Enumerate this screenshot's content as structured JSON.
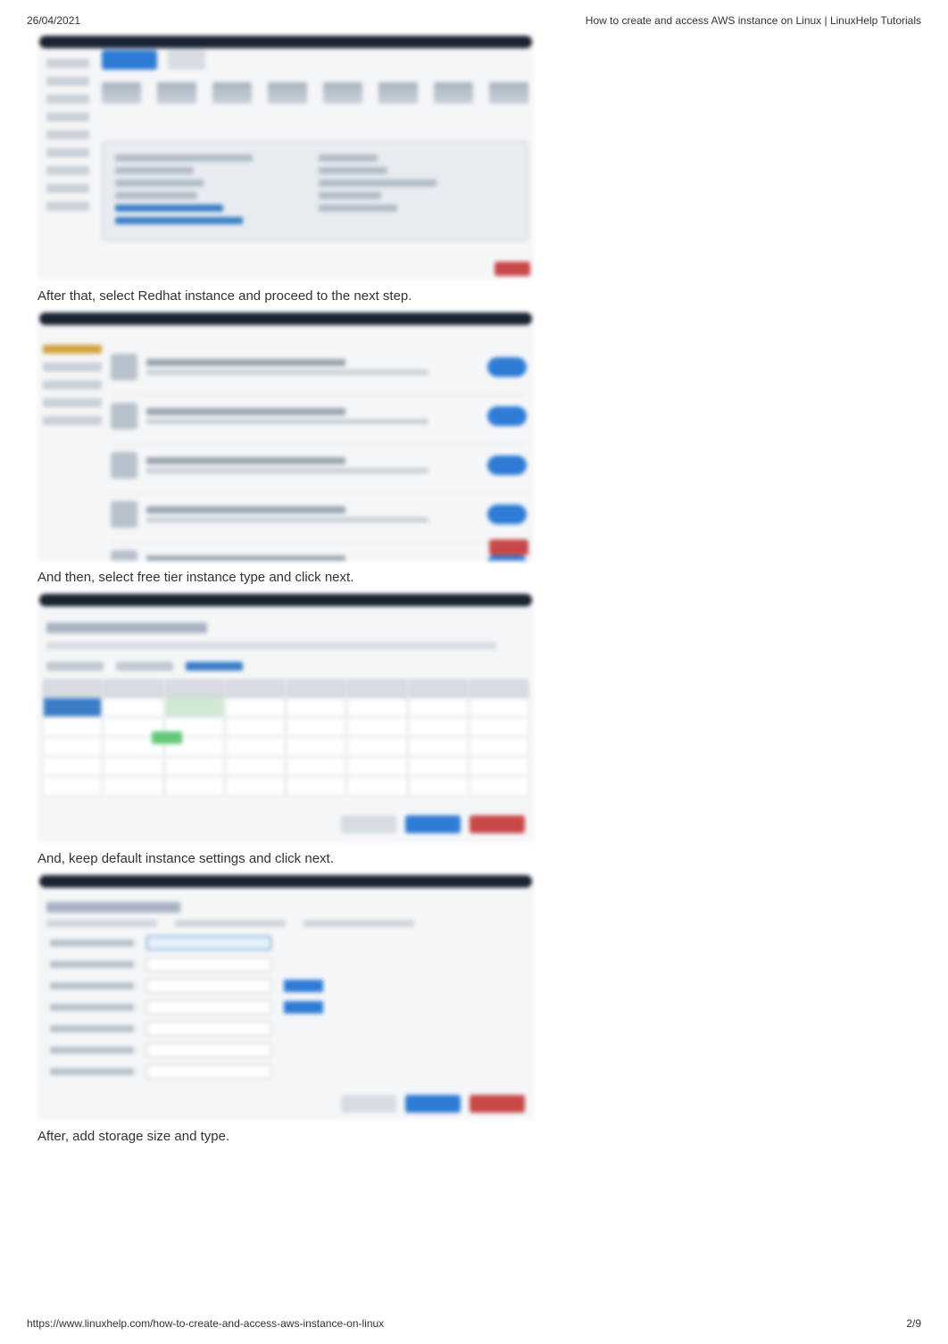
{
  "header": {
    "date": "26/04/2021",
    "title": "How to create and access AWS instance on Linux | LinuxHelp Tutorials"
  },
  "steps": {
    "step1": "After that, select Redhat instance and proceed to the next step.",
    "step2": "And then, select free tier instance type and click next.",
    "step3": "And, keep default instance settings and click next.",
    "step4": "After, add storage size and type."
  },
  "footer": {
    "url": "https://www.linuxhelp.com/how-to-create-and-access-aws-instance-on-linux",
    "page": "2/9"
  }
}
